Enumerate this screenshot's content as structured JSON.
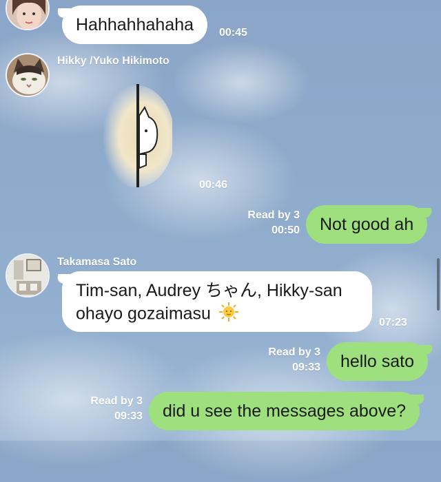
{
  "messages": [
    {
      "type": "incoming",
      "text": "Hahhahhahaha",
      "time": "00:45"
    },
    {
      "type": "sticker",
      "sender": "Hikky /Yuko Hikimoto",
      "time": "00:46",
      "icon": "cat-peeking-sticker"
    },
    {
      "type": "outgoing",
      "text": "Not good ah",
      "read": "Read by 3",
      "time": "00:50"
    },
    {
      "type": "incoming",
      "sender": "Takamasa Sato",
      "line1": "Tim-san, Audrey ちゃん, Hikky-san",
      "line2": "ohayo gozaimasu",
      "emoji": "🌞",
      "time": "07:23"
    },
    {
      "type": "outgoing",
      "text": "hello sato",
      "read": "Read by 3",
      "time": "09:33"
    },
    {
      "type": "outgoing",
      "text": "did u see the messages above?",
      "read": "Read by 3",
      "time": "09:33"
    }
  ],
  "colors": {
    "incoming_bubble": "#ffffff",
    "outgoing_bubble": "#9ee07e",
    "background": "#8fabcc"
  }
}
